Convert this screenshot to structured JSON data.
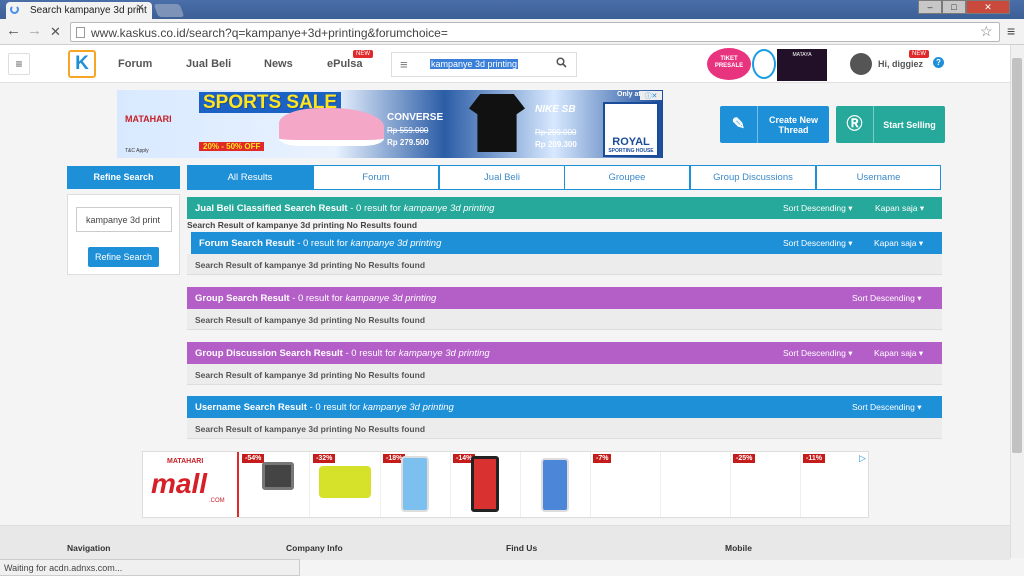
{
  "browser": {
    "tab_title": "Search kampanye 3d print",
    "url": "www.kaskus.co.id/search?q=kampanye+3d+printing&forumchoice=",
    "status": "Waiting for acdn.adnxs.com...",
    "win_min": "–",
    "win_max": "□",
    "win_close": "✕"
  },
  "header": {
    "logo": "K",
    "nav": [
      "Forum",
      "Jual Beli",
      "News",
      "ePulsa"
    ],
    "new_badge": "NEW",
    "search_query": "kampanye 3d printing",
    "tiket": "TIKET PRESALE",
    "mataya": "MATAYA",
    "greeting": "Hi, diggiez",
    "help": "?"
  },
  "banner": {
    "brand": "MATAHARI",
    "sale": "SPORTS SALE",
    "discount": "20% - 50% OFF",
    "tac": "T&C Apply",
    "converse": "CONVERSE",
    "converse_old": "Rp 559.000",
    "converse_new": "Rp 279.500",
    "nike": "NIKE SB",
    "nike_old": "Rp 299.000",
    "nike_new": "Rp 209.300",
    "royal": "ROYAL",
    "royal_sub": "SPORTING HOUSE",
    "only_at": "Only at"
  },
  "actions": {
    "create_thread": "Create New Thread",
    "start_selling": "Start Selling"
  },
  "refine": {
    "header": "Refine Search",
    "input_value": "kampanye 3d print",
    "button": "Refine Search"
  },
  "tabs": [
    "All Results",
    "Forum",
    "Jual Beli",
    "Groupee",
    "Group Discussions",
    "Username"
  ],
  "sections": [
    {
      "title": "Jual Beli Classified Search Result",
      "count": " - 0 result for ",
      "query": "kampanye 3d printing",
      "sort": "Sort Descending",
      "time": "Kapan saja",
      "empty": "Search Result of kampanye 3d printing No Results found"
    },
    {
      "title": "Forum Search Result",
      "count": " - 0 result for ",
      "query": "kampanye 3d printing",
      "sort": "Sort Descending",
      "time": "Kapan saja",
      "empty": "Search Result of kampanye 3d printing No Results found"
    },
    {
      "title": "Group Search Result",
      "count": " - 0 result for ",
      "query": "kampanye 3d printing",
      "sort": "Sort Descending",
      "empty": "Search Result of kampanye 3d printing No Results found"
    },
    {
      "title": "Group Discussion Search Result",
      "count": " - 0 result for ",
      "query": "kampanye 3d printing",
      "sort": "Sort Descending",
      "time": "Kapan saja",
      "empty": "Search Result of kampanye 3d printing No Results found"
    },
    {
      "title": "Username Search Result",
      "count": " - 0 result for ",
      "query": "kampanye 3d printing",
      "sort": "Sort Descending",
      "empty": "Search Result of kampanye 3d printing No Results found"
    }
  ],
  "mall_ad": {
    "brand": "MATAHARI",
    "word": "mall",
    "dotcom": ".COM",
    "discounts": [
      "-54%",
      "-32%",
      "-18%",
      "-14%",
      "",
      "-7%",
      "",
      "-25%",
      "-11%"
    ]
  },
  "footer": [
    "Navigation",
    "Company Info",
    "Find Us",
    "Mobile"
  ],
  "colors": {
    "teal": "#26a89a",
    "blue": "#1e90d8",
    "purple": "#b45ec8"
  }
}
